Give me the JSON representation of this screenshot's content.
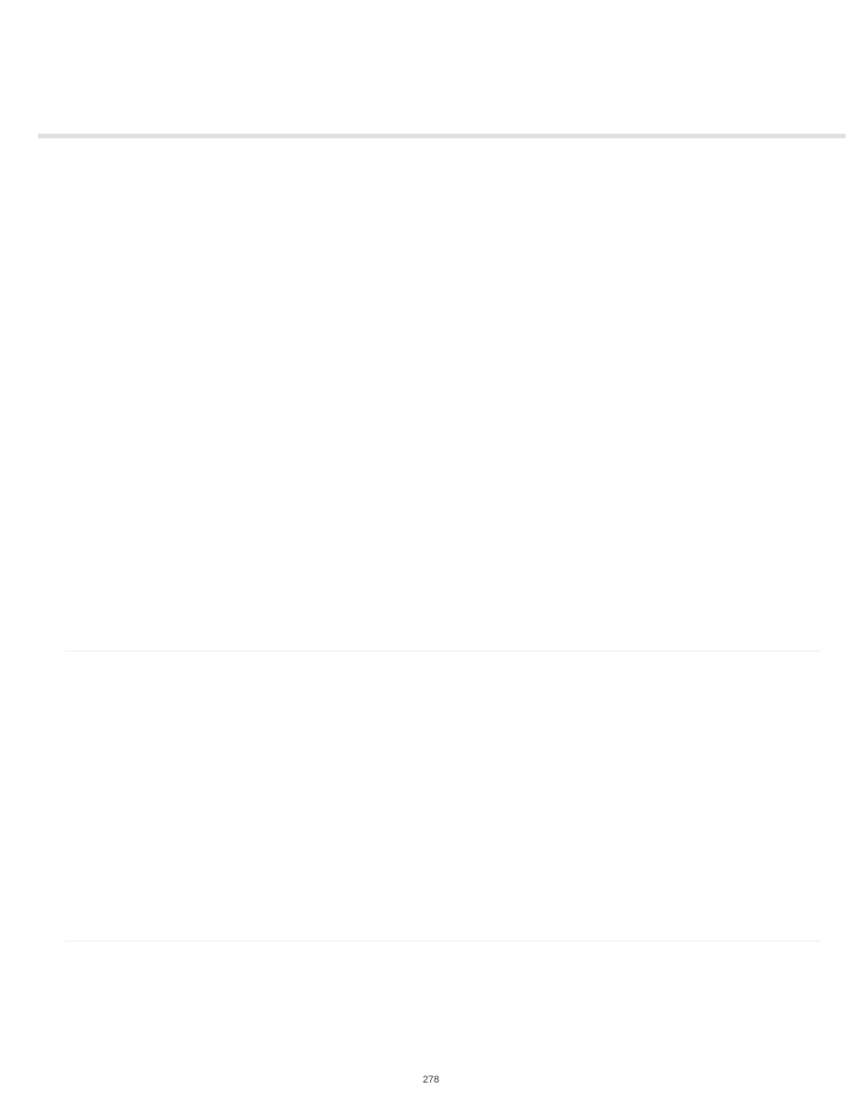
{
  "page_number": "278"
}
